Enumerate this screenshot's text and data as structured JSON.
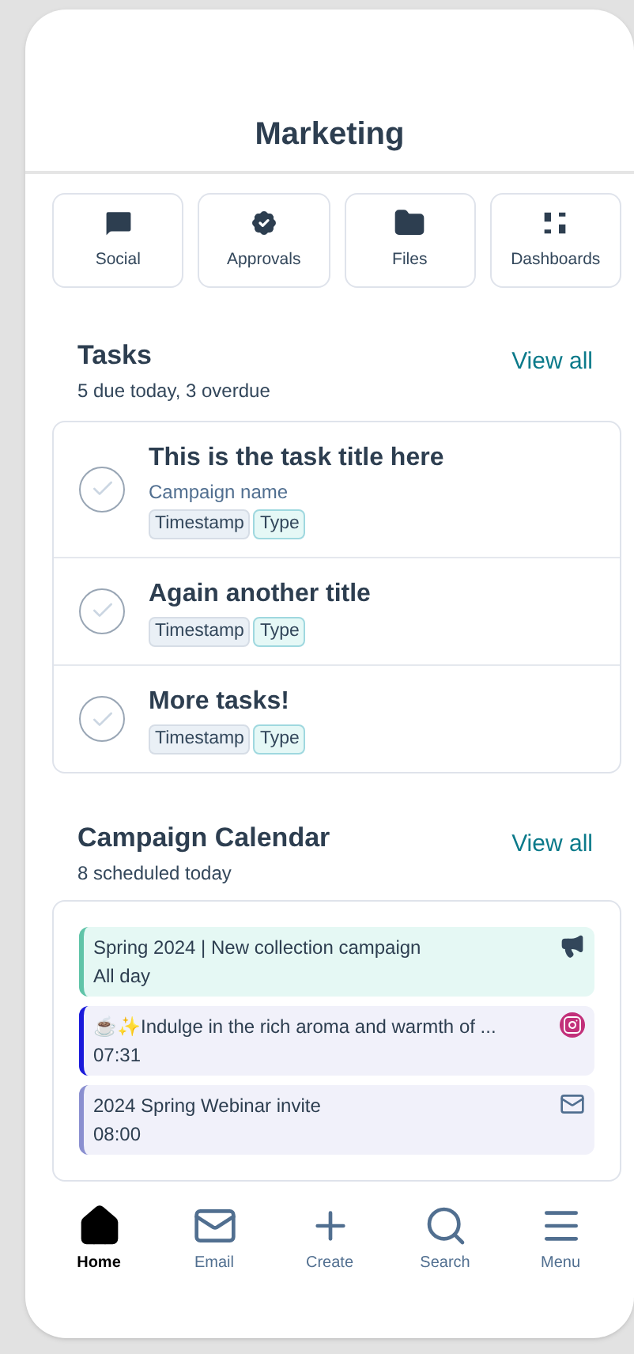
{
  "header": {
    "title": "Marketing"
  },
  "shortcuts": [
    {
      "label": "Social",
      "kind": "social"
    },
    {
      "label": "Approvals",
      "kind": "approvals"
    },
    {
      "label": "Files",
      "kind": "files"
    },
    {
      "label": "Dashboards",
      "kind": "dashboards"
    }
  ],
  "tasks": {
    "title": "Tasks",
    "subtitle": "5 due today, 3 overdue",
    "view_all": "View all",
    "items": [
      {
        "title": "This is the task title here",
        "campaign": "Campaign name",
        "tags": [
          "Timestamp",
          "Type"
        ],
        "checked": false
      },
      {
        "title": "Again another title",
        "tags": [
          "Timestamp",
          "Type"
        ],
        "checked": false
      },
      {
        "title": "More tasks!",
        "tags": [
          "Timestamp",
          "Type"
        ],
        "checked": false
      }
    ]
  },
  "calendar": {
    "title": "Campaign Calendar",
    "subtitle": "8 scheduled today",
    "view_all": "View all",
    "items": [
      {
        "title": "Spring 2024 | New collection campaign",
        "time": "All day",
        "color": "#5fc4a8",
        "kind": "campaign"
      },
      {
        "title": "☕✨Indulge in the rich aroma and warmth of ...",
        "time": "07:31",
        "color": "#1a1adb",
        "kind": "social"
      },
      {
        "title": "2024 Spring Webinar invite",
        "time": "08:00",
        "color": "#8a8fd0",
        "kind": "email"
      }
    ]
  },
  "nav": [
    {
      "label": "Home",
      "kind": "home",
      "selected": true
    },
    {
      "label": "Email",
      "kind": "email",
      "selected": false
    },
    {
      "label": "Create",
      "kind": "create",
      "selected": false
    },
    {
      "label": "Search",
      "kind": "search",
      "selected": false
    },
    {
      "label": "Menu",
      "kind": "menu",
      "selected": false
    }
  ]
}
